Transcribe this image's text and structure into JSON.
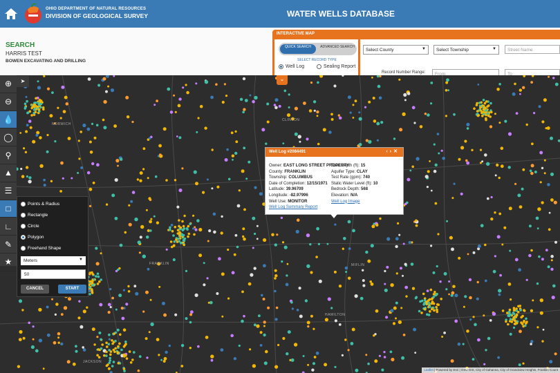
{
  "header": {
    "org_line1": "OHIO DEPARTMENT OF NATURAL RESOURCES",
    "org_line2": "DIVISION OF GEOLOGICAL SURVEY",
    "title": "WATER WELLS DATABASE"
  },
  "search": {
    "heading": "SEARCH",
    "user": "HARRIS TEST",
    "company": "BOWEN EXCAVATING AND DRILLING"
  },
  "interactive_map": {
    "title": "INTERACTIVE MAP",
    "quick_search": "QUICK SEARCH",
    "advanced_search": "ADVANCED SEARCH",
    "record_type_label": "SELECT RECORD TYPE",
    "record_types": [
      "Well Log",
      "Sealing Report"
    ],
    "selected_record_type": "Well Log",
    "county_select": "Select County",
    "township_select": "Select Township",
    "street_placeholder": "Street Name",
    "record_range_label": "Record Number Range:",
    "from_placeholder": "From",
    "to_placeholder": "To"
  },
  "draw_tool": {
    "options": [
      "Points & Radius",
      "Rectangle",
      "Circle",
      "Polygon",
      "Freehand Shape"
    ],
    "selected": "Polygon",
    "units": "Meters",
    "value": "50",
    "cancel": "CANCEL",
    "start": "START"
  },
  "popup": {
    "title": "Well Log #2084491",
    "left": [
      {
        "label": "Owner:",
        "value": "EAST LONG STREET PROPERTY"
      },
      {
        "label": "County:",
        "value": "FRANKLIN"
      },
      {
        "label": "Township:",
        "value": "COLUMBUS"
      },
      {
        "label": "Date of Completion:",
        "value": "12/15/1971"
      },
      {
        "label": "Latitude:",
        "value": "39.96709"
      },
      {
        "label": "Longitude:",
        "value": "-82.97996"
      },
      {
        "label": "Well Use:",
        "value": "MONITOR"
      }
    ],
    "right": [
      {
        "label": "Total Depth (ft):",
        "value": "15"
      },
      {
        "label": "Aquifer Type:",
        "value": "CLAY"
      },
      {
        "label": "Test Rate (gpm):",
        "value": "740"
      },
      {
        "label": "Static Water Level (ft):",
        "value": "10"
      },
      {
        "label": "Bedrock Depth:",
        "value": "568"
      },
      {
        "label": "Elevation:",
        "value": "N/A"
      }
    ],
    "link_left": "Well Log Summary Report",
    "link_right": "Well Log Image"
  },
  "map_labels": [
    "NORWICH",
    "CLINTON",
    "FRANKLIN",
    "MIFLIN",
    "HAMILTON",
    "JACKSON"
  ],
  "attribution": {
    "leaflet": "Leaflet",
    "rest": " | Powered by Esri | OSU GIS, City of Gahanna, City of Grandview Heights, Franklin Count"
  },
  "toolbar_icons": [
    "zoom-in-icon",
    "zoom-out-icon",
    "water-drop-icon",
    "drop-outline-icon",
    "search-icon",
    "shapes-icon",
    "layers-icon",
    "draw-polygon-icon",
    "ruler-icon",
    "pencil-icon",
    "star-icon"
  ],
  "colors": {
    "header": "#3a7bb6",
    "accent": "#e8731f",
    "search_green": "#2f8a3a",
    "well_yellow": "#f2b705",
    "well_teal": "#3fbfa8"
  }
}
